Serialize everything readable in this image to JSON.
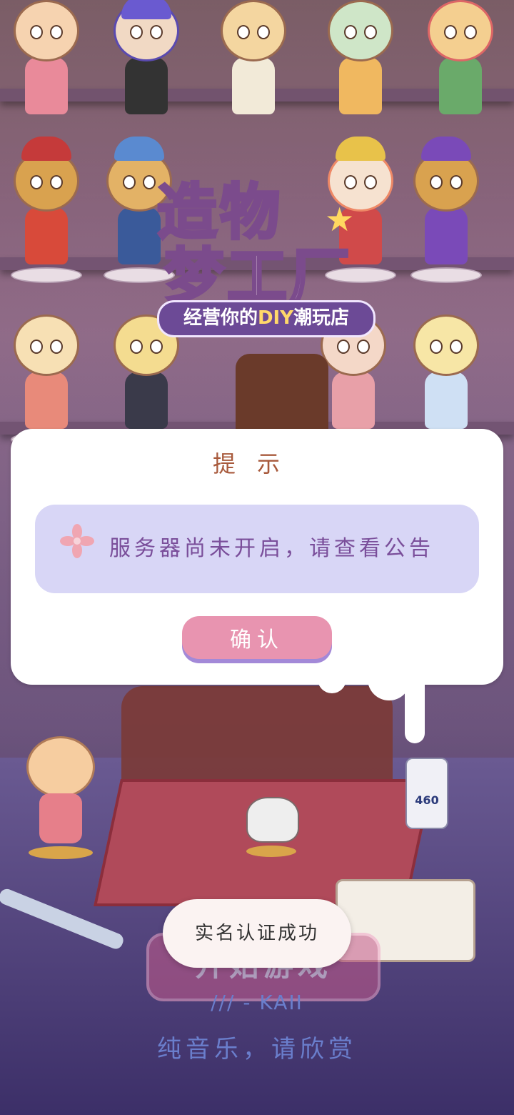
{
  "background": {
    "logo_line1": "造物",
    "logo_line2": "梦工厂",
    "logo_tagline_prefix": "经营你的",
    "logo_tagline_diy": "DIY",
    "logo_tagline_suffix": "潮玩店",
    "glue_label": "460",
    "start_button_label": "开始游戏",
    "credit": "/// - KAII",
    "music_note": "纯音乐，请欣赏"
  },
  "dialog": {
    "title": "提示",
    "message": "服务器尚未开启，请查看公告",
    "confirm_label": "确认"
  },
  "toast": {
    "text": "实名认证成功"
  },
  "colors": {
    "dialog_bg": "#ffffff",
    "message_box_bg": "#d8d6f6",
    "confirm_bg": "#e894b0",
    "title_color": "#a85a3c",
    "message_color": "#7a4e9a"
  }
}
